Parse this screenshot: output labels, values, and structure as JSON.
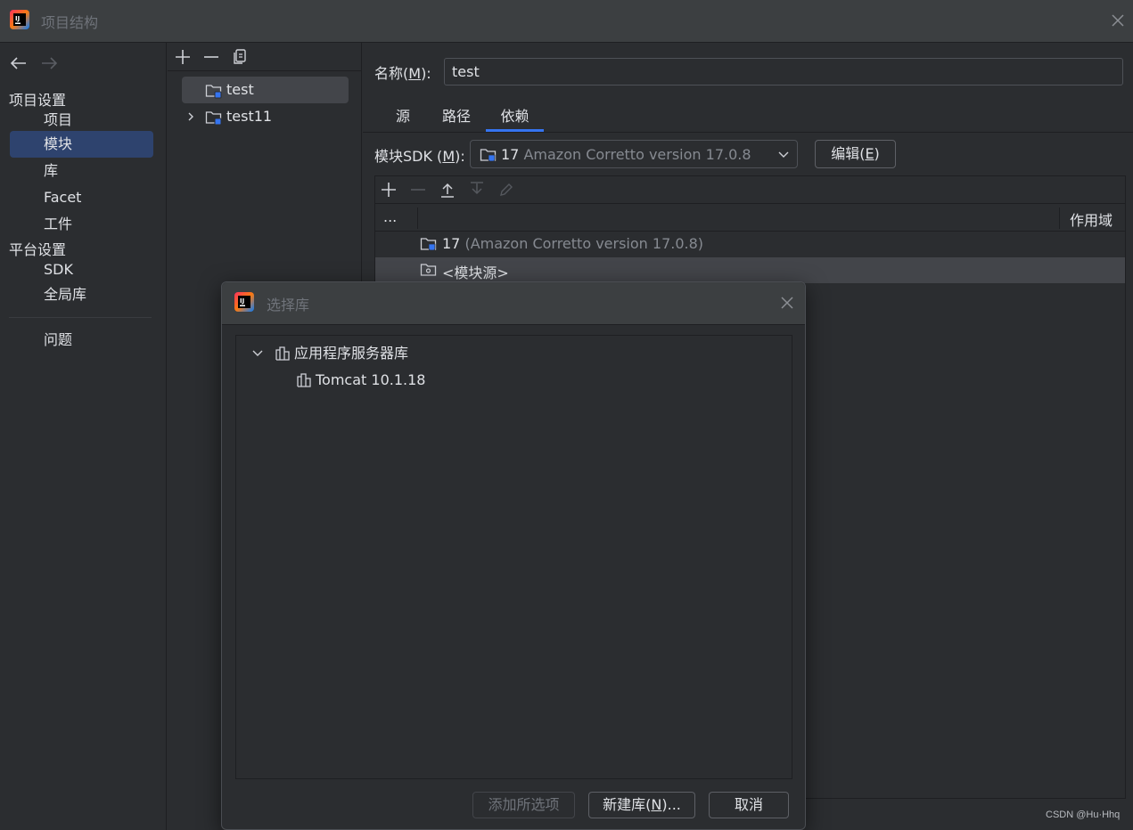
{
  "window": {
    "title": "项目结构"
  },
  "nav": {
    "project_settings_label": "项目设置",
    "project_settings_items": [
      "项目",
      "模块",
      "库",
      "Facet",
      "工件"
    ],
    "selected_item": "模块",
    "platform_settings_label": "平台设置",
    "platform_settings_items": [
      "SDK",
      "全局库"
    ],
    "problems_label": "问题"
  },
  "modules": {
    "items": [
      {
        "name": "test",
        "selected": true,
        "expandable": false
      },
      {
        "name": "test11",
        "selected": false,
        "expandable": true
      }
    ]
  },
  "module_detail": {
    "name_label": "名称(M):",
    "name_label_parts": [
      "名称(",
      "M",
      "):"
    ],
    "name_value": "test",
    "tabs": [
      "源",
      "路径",
      "依赖"
    ],
    "active_tab": "依赖",
    "sdk_label_parts": [
      "模块SDK (",
      "M",
      "):"
    ],
    "sdk_value_main": "17",
    "sdk_value_detail": "Amazon Corretto version 17.0.8",
    "edit_button_parts": [
      "编辑(",
      "E",
      ")"
    ],
    "table": {
      "header_left": "...",
      "header_scope": "作用域",
      "rows": [
        {
          "main": "17",
          "detail": "(Amazon Corretto version 17.0.8)",
          "selected": false
        },
        {
          "main": "<模块源>",
          "detail": "",
          "selected": true
        }
      ]
    }
  },
  "dialog": {
    "title": "选择库",
    "tree": {
      "group_label": "应用程序服务器库",
      "group_expanded": true,
      "children": [
        "Tomcat 10.1.18"
      ]
    },
    "buttons": {
      "add_selected": "添加所选项",
      "new_library_parts": [
        "新建库(",
        "N",
        ")..."
      ],
      "cancel": "取消"
    }
  },
  "watermark": "CSDN @Hu·Hhq",
  "colors": {
    "background": "#2b2d30",
    "titlebar": "#3c3f41",
    "selection": "#2e436e",
    "accent": "#3574f0"
  }
}
